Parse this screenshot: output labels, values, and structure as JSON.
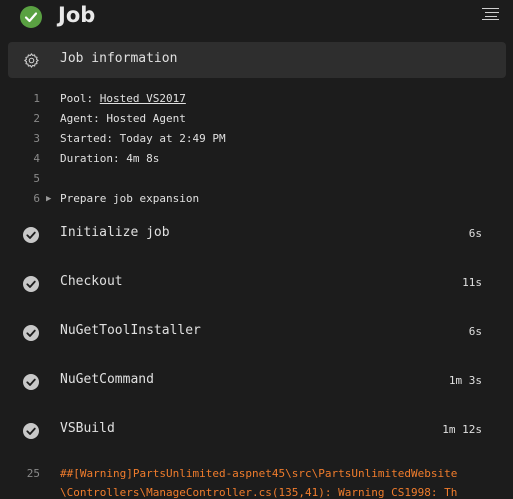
{
  "header": {
    "title": "Job"
  },
  "job_info": {
    "label": "Job information"
  },
  "log": [
    {
      "num": "1",
      "prefix": "Pool: ",
      "link": "Hosted VS2017"
    },
    {
      "num": "2",
      "text": "Agent: Hosted Agent"
    },
    {
      "num": "3",
      "text": "Started: Today at 2:49 PM"
    },
    {
      "num": "4",
      "text": "Duration: 4m 8s"
    },
    {
      "num": "5",
      "text": ""
    },
    {
      "num": "6",
      "text": "Prepare job expansion"
    }
  ],
  "steps": [
    {
      "name": "Initialize job",
      "duration": "6s"
    },
    {
      "name": "Checkout",
      "duration": "11s"
    },
    {
      "name": "NuGetToolInstaller",
      "duration": "6s"
    },
    {
      "name": "NuGetCommand",
      "duration": "1m 3s"
    },
    {
      "name": "VSBuild",
      "duration": "1m 12s"
    }
  ],
  "warning": {
    "num": "25",
    "line1": "##[Warning]PartsUnlimited-aspnet45\\src\\PartsUnlimitedWebsite",
    "line2": "\\Controllers\\ManageController.cs(135,41): Warning CS1998: Th"
  },
  "colors": {
    "success": "#5aa142",
    "warning": "#f07c2c",
    "background": "#1c1c1c"
  },
  "icons": {
    "status": "check-circle-icon",
    "menu": "menu-lines-icon",
    "job_info": "gear-icon",
    "step": "check-circle-icon",
    "expand": "caret-right-icon"
  }
}
